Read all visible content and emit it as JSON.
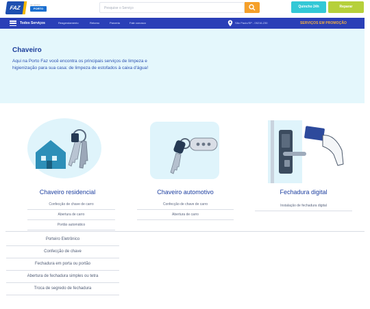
{
  "header": {
    "logo_faz": "FAZ",
    "logo_porto_small": "um serviço",
    "logo_porto": "PORTO",
    "search_placeholder": "Pesquise o Serviço",
    "quick_button": "Quincho 24h",
    "repair_button": "Reparar"
  },
  "nav": {
    "all_services": "Todos Serviços",
    "links": [
      "Reagendamento",
      "Retorno",
      "Parceria",
      "Fale conosco"
    ],
    "location": "São Paulo/SP - 05216-230",
    "promo": "SERVIÇOS EM PROMOÇÃO"
  },
  "hero": {
    "title": "Chaveiro",
    "description": "Aqui na Porto Faz você encontra os principais serviços de limpeza e higienização para sua casa: de limpeza de estofados à caixa d'água!"
  },
  "cards": [
    {
      "title": "Chaveiro residencial",
      "items": [
        "Confecção de chave de carro",
        "Abertura de carro",
        "Portão automático"
      ]
    },
    {
      "title": "Chaveiro automotivo",
      "items": [
        "Confecção de chave de carro",
        "Abertura de carro"
      ]
    },
    {
      "title": "Fechadura digital",
      "items": [
        "Instalação de fechadura digital"
      ]
    }
  ],
  "extra_items": [
    "Porteiro Eletrônico",
    "Confecção de chave",
    "Fechadura em porta ou portão",
    "Abertura de fechadura simples ou tetra",
    "Troca de segredo de fechadura"
  ],
  "colors": {
    "primary": "#2a3fb7",
    "hero_bg": "#e4f7fc",
    "accent_orange": "#f5a02a",
    "quick_teal": "#33c8d6",
    "repair_green": "#b6d03a",
    "promo_text": "#f7b03c"
  }
}
